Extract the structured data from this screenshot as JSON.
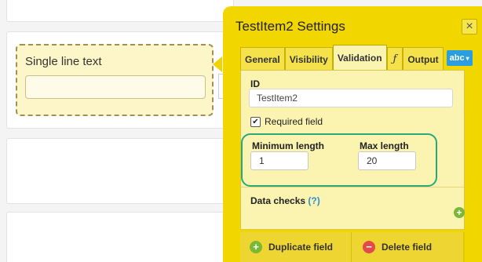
{
  "form": {
    "field_label": "Single line text"
  },
  "panel": {
    "title": "TestItem2 Settings",
    "close_icon": "×",
    "tabs": [
      {
        "label": "General"
      },
      {
        "label": "Visibility"
      },
      {
        "label": "Validation",
        "active": true
      },
      {
        "label": "ƒ"
      },
      {
        "label": "Output"
      }
    ],
    "type_dropdown": {
      "label": "abc",
      "caret": "▾"
    },
    "id_label": "ID",
    "id_value": "TestItem2",
    "required": {
      "label": "Required field",
      "checked": true,
      "check_glyph": "✔"
    },
    "min_length": {
      "label": "Minimum length",
      "value": "1"
    },
    "max_length": {
      "label": "Max length",
      "value": "20"
    },
    "data_checks": {
      "label": "Data checks",
      "help": "(?)"
    },
    "buttons": {
      "duplicate": "Duplicate field",
      "delete": "Delete field"
    }
  },
  "icons": {
    "close": "close-icon",
    "add": "plus-circle-icon",
    "delete": "minus-circle-icon",
    "check": "checkmark-icon",
    "function": "function-icon"
  },
  "colors": {
    "panel_bg": "#f1d600",
    "panel_body": "#fbf3b0",
    "highlight_ring": "#2aa877",
    "accent_blue": "#2a9ee0",
    "add_green": "#79b934",
    "delete_red": "#e04b4b"
  }
}
